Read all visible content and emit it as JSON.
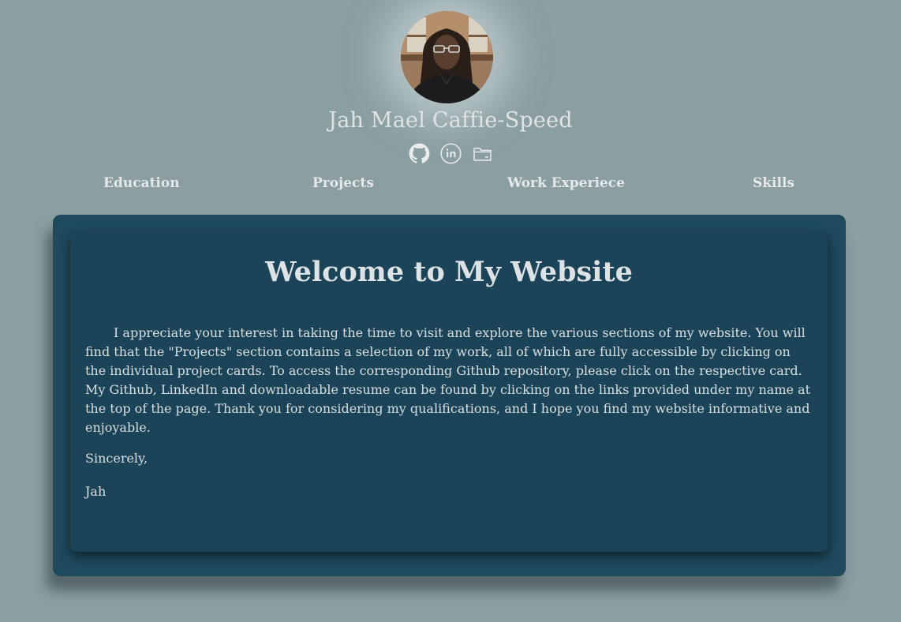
{
  "profile": {
    "name": "Jah Mael Caffie-Speed",
    "avatar_alt": "Profile photo of Jah Mael Caffie-Speed"
  },
  "social": [
    {
      "icon": "github-icon"
    },
    {
      "icon": "linkedin-icon"
    },
    {
      "icon": "folder-resume-icon"
    }
  ],
  "nav": {
    "items": [
      {
        "label": "Education"
      },
      {
        "label": "Projects"
      },
      {
        "label": "Work Experiece"
      },
      {
        "label": "Skills"
      }
    ]
  },
  "main": {
    "title": "Welcome to My Website",
    "body": "I appreciate your interest in taking the time to visit and explore the various sections of my website. You will find that the \"Projects\" section contains a selection of my work, all of which are fully accessible by clicking on the individual project cards. To access the corresponding Github repository, please click on the respective card. My Github, LinkedIn and downloadable resume can be found by clicking on the links provided under my name at the top of the page. Thank you for considering my qualifications, and I hope you find my website informative and enjoyable.",
    "closing": "Sincerely,",
    "signature": "Jah"
  },
  "colors": {
    "page_background": "#8b9fa3",
    "card_outer": "#1f4a5e",
    "card_inner": "#1c4459",
    "text_light": "#dfe3e4"
  }
}
